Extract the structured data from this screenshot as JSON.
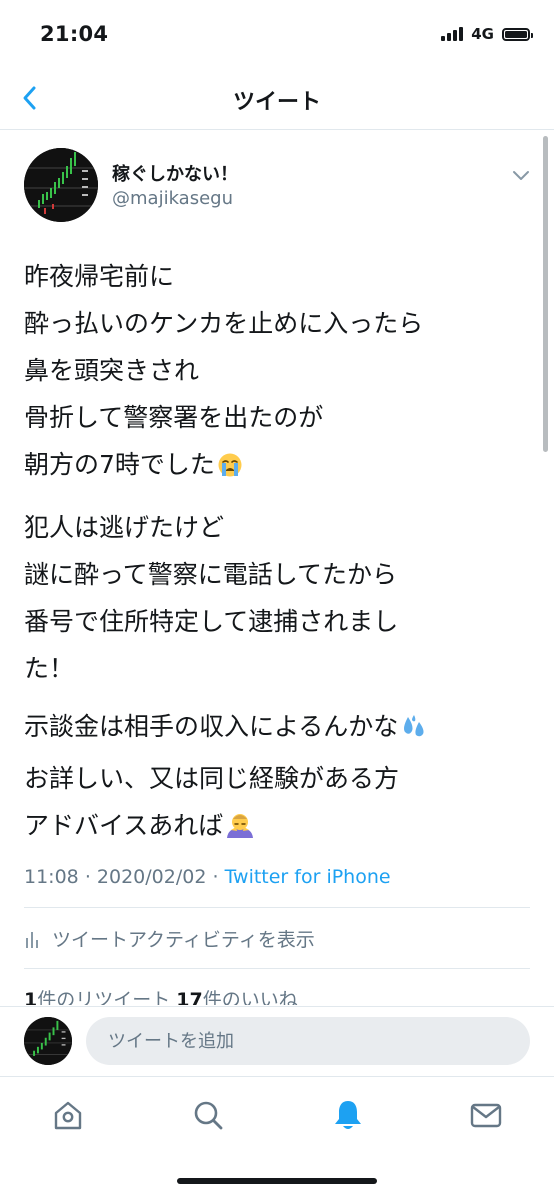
{
  "status_bar": {
    "time": "21:04",
    "network": "4G"
  },
  "nav": {
    "title": "ツイート"
  },
  "author": {
    "name": "稼ぐしかない！",
    "handle": "@majikasegu"
  },
  "tweet": {
    "paragraphs": [
      [
        "昨夜帰宅前に",
        "酔っ払いのケンカを止めに入ったら",
        "鼻を頭突きされ",
        "骨折して警察署を出たのが",
        "朝方の7時でした"
      ],
      [
        "犯人は逃げたけど",
        "謎に酔って警察に電話してたから",
        "番号で住所特定して逮捕されまし",
        "た！"
      ],
      [
        "示談金は相手の収入によるんかな",
        "お詳しい、又は同じ経験がある方",
        "アドバイスあれば"
      ]
    ],
    "emoji": {
      "crying": "crying-face-emoji",
      "sweat": "sweat-droplets-emoji",
      "bow": "bowing-person-emoji"
    },
    "time": "11:08",
    "date": "2020/02/02",
    "separator": "·",
    "source": "Twitter for iPhone"
  },
  "activity": {
    "label": "ツイートアクティビティを表示"
  },
  "counts": {
    "retweets": "1",
    "retweets_label": "件のリツイート",
    "likes": "17",
    "likes_label": "件のいいね"
  },
  "compose": {
    "placeholder": "ツイートを追加"
  },
  "colors": {
    "accent": "#1da1f2",
    "text": "#14171a",
    "secondary": "#657786",
    "divider": "#e1e8ed"
  },
  "tabs": [
    {
      "icon": "home-icon",
      "active": false
    },
    {
      "icon": "search-icon",
      "active": false
    },
    {
      "icon": "notifications-icon",
      "active": true
    },
    {
      "icon": "messages-icon",
      "active": false
    }
  ]
}
